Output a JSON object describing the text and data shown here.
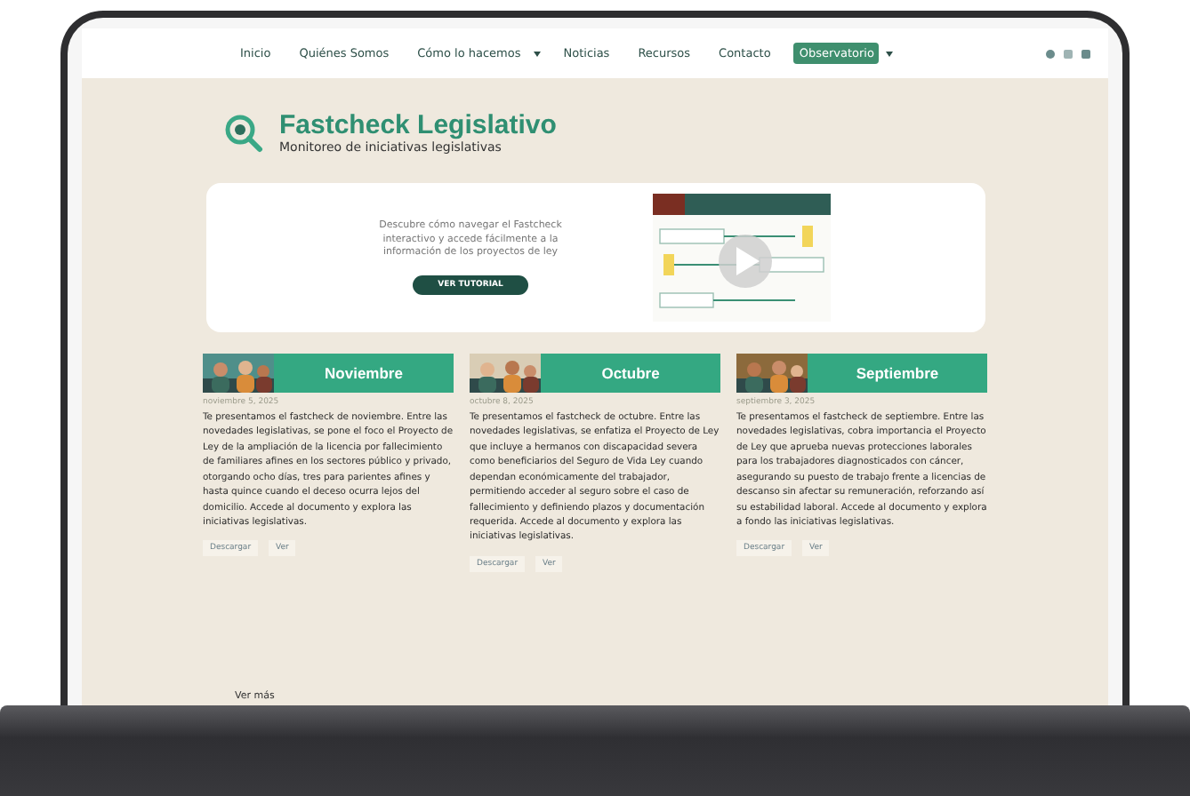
{
  "nav": {
    "items": [
      {
        "label": "Inicio",
        "dropdown": false,
        "selected": false
      },
      {
        "label": "Quiénes Somos",
        "dropdown": false,
        "selected": false
      },
      {
        "label": "Cómo lo hacemos",
        "dropdown": true,
        "selected": false
      },
      {
        "label": "Noticias",
        "dropdown": false,
        "selected": false
      },
      {
        "label": "Recursos",
        "dropdown": false,
        "selected": false
      },
      {
        "label": "Contacto",
        "dropdown": false,
        "selected": false
      },
      {
        "label": "Observatorio",
        "dropdown": true,
        "selected": true
      }
    ]
  },
  "header": {
    "title": "Fastcheck Legislativo",
    "subtitle": "Monitoreo de iniciativas legislativas"
  },
  "tutorial": {
    "text": "Descubre cómo navegar el Fastcheck interactivo y accede fácilmente a la información de los proyectos de ley",
    "button": "VER TUTORIAL"
  },
  "cards": [
    {
      "title": "Noviembre",
      "date": "noviembre 5, 2025",
      "body": "Te presentamos el fastcheck de noviembre. Entre las novedades legislativas, se pone el foco el Proyecto de Ley de la ampliación de la licencia por fallecimiento de familiares afines en los sectores público y privado, otorgando ocho días, tres para parientes afines y hasta quince cuando el deceso ocurra lejos del domicilio. Accede al documento y explora las iniciativas legislativas.",
      "links": [
        "Descargar",
        "Ver"
      ]
    },
    {
      "title": "Octubre",
      "date": "octubre 8, 2025",
      "body": "Te presentamos el fastcheck de octubre. Entre las novedades legislativas, se enfatiza el Proyecto de Ley que incluye a hermanos con discapacidad severa como beneficiarios del Seguro de Vida Ley cuando dependan económicamente del trabajador, permitiendo acceder al seguro sobre el caso de fallecimiento y definiendo plazos y documentación requerida. Accede al documento y explora las iniciativas legislativas.",
      "links": [
        "Descargar",
        "Ver"
      ]
    },
    {
      "title": "Septiembre",
      "date": "septiembre 3, 2025",
      "body": "Te presentamos el fastcheck de septiembre. Entre las novedades legislativas, cobra importancia el Proyecto de Ley que aprueba nuevas protecciones laborales para los trabajadores diagnosticados con cáncer, asegurando su puesto de trabajo frente a licencias de descanso sin afectar su remuneración, reforzando así su estabilidad laboral. Accede al documento y explora a fondo las iniciativas legislativas.",
      "links": [
        "Descargar",
        "Ver"
      ]
    }
  ],
  "more": "Ver más"
}
